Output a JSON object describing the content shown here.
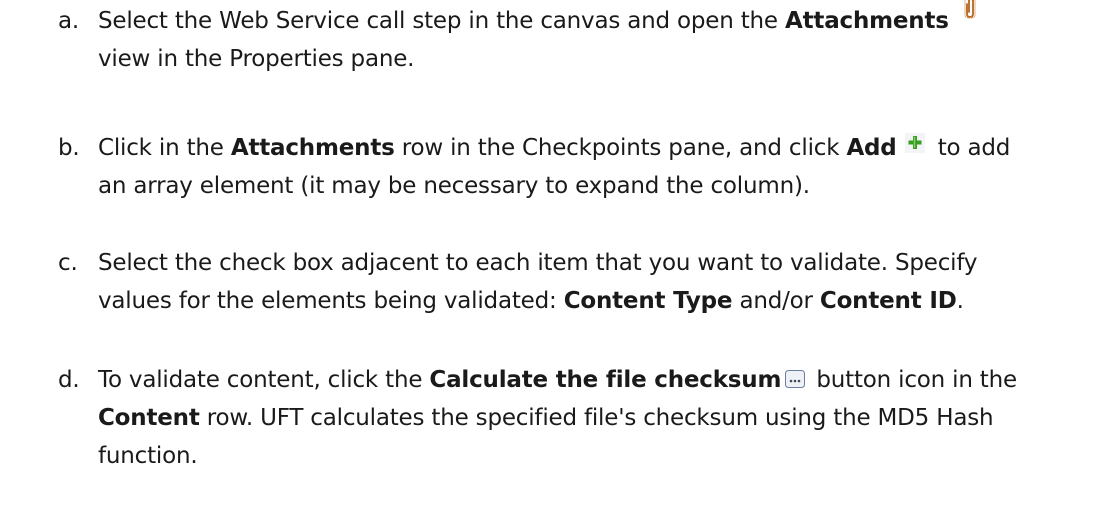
{
  "steps": [
    {
      "marker": "a.",
      "line1_pre": "Select the Web Service call step in the canvas and open the ",
      "line1_bold": "Attachments",
      "icon": "paperclip-icon",
      "line2": "view in the Properties pane."
    },
    {
      "marker": "b.",
      "line1_pre": "Click in the ",
      "line1_bold1": "Attachments",
      "line1_mid": " row in the Checkpoints pane, and click ",
      "line1_bold2": "Add",
      "icon": "add-plus-icon",
      "line1_post": " to add",
      "line2": "an array element (it may be necessary to expand the column)."
    },
    {
      "marker": "c.",
      "line1": "Select the check box adjacent to each item that you want to validate. Specify",
      "line2_pre": "values for the elements being validated: ",
      "line2_bold1": "Content Type",
      "line2_mid": " and/or ",
      "line2_bold2": "Content ID",
      "line2_post": "."
    },
    {
      "marker": "d.",
      "line1_pre": "To validate content, click the ",
      "line1_bold": "Calculate the file checksum",
      "icon": "ellipsis-button-icon",
      "line1_post": " button icon in the",
      "line2_bold": "Content",
      "line2_post": " row. UFT calculates the specified file's checksum using the MD5 Hash",
      "line3": "function."
    }
  ],
  "colors": {
    "text": "#1a1a1a",
    "paperclip": "#b5651d",
    "plus": "#3a9d23",
    "button_border": "#6a7fa0"
  }
}
